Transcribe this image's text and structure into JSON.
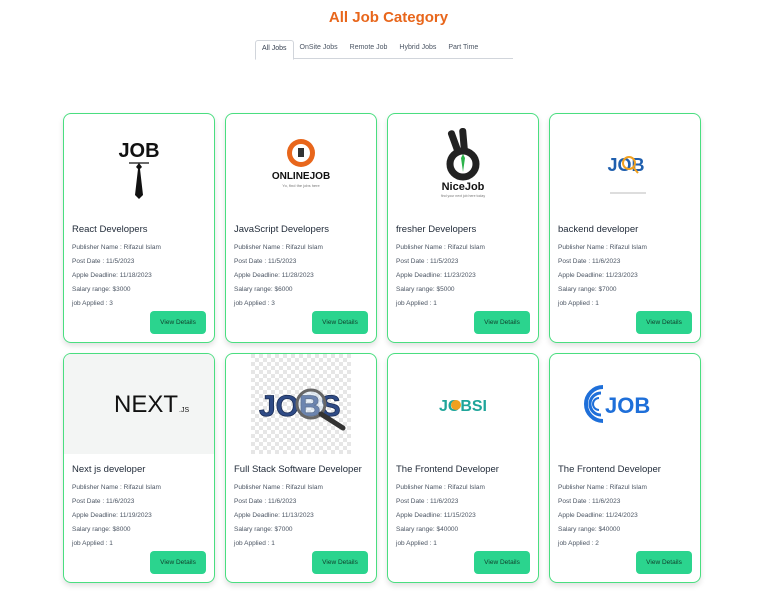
{
  "page": {
    "title": "All Job Category"
  },
  "tabs": [
    "All Jobs",
    "OnSite Jobs",
    "Remote Job",
    "Hybrid Jobs",
    "Part Time"
  ],
  "labels": {
    "publisher": "Publisher Name : ",
    "post_date": "Post Date : ",
    "deadline": "Apple Deadline: ",
    "salary": "Salary range: ",
    "applied": "job Applied : ",
    "button": "View Details"
  },
  "logo_text": {
    "job": "JOB",
    "onlinejob": "ONLINEJOB",
    "onlinejob_tag": "Yo, find the jobs here",
    "nicejob": "NiceJob",
    "nicejob_tag": "find your next job here today",
    "searchjob": "JOB",
    "nextjs": "NEXT",
    "nextjs_suffix": ".JS",
    "jobs": "JOBS",
    "jobsi": "JOBSI",
    "job_blue": "JOB"
  },
  "jobs": [
    {
      "title": "React Developers",
      "publisher": "Rifazul Islam",
      "post_date": "11/5/2023",
      "deadline": "11/18/2023",
      "salary": "$3000",
      "applied": "3"
    },
    {
      "title": "JavaScript Developers",
      "publisher": "Rifazul Islam",
      "post_date": "11/5/2023",
      "deadline": "11/28/2023",
      "salary": "$6000",
      "applied": "3"
    },
    {
      "title": "fresher Developers",
      "publisher": "Rifazul Islam",
      "post_date": "11/5/2023",
      "deadline": "11/23/2023",
      "salary": "$5000",
      "applied": "1"
    },
    {
      "title": "backend developer",
      "publisher": "Rifazul Islam",
      "post_date": "11/6/2023",
      "deadline": "11/23/2023",
      "salary": "$7000",
      "applied": "1"
    },
    {
      "title": "Next js developer",
      "publisher": "Rifazul Islam",
      "post_date": "11/6/2023",
      "deadline": "11/19/2023",
      "salary": "$8000",
      "applied": "1"
    },
    {
      "title": "Full Stack Software Developer",
      "publisher": "Rifazul Islam",
      "post_date": "11/6/2023",
      "deadline": "11/13/2023",
      "salary": "$7000",
      "applied": "1"
    },
    {
      "title": "The Frontend Developer",
      "publisher": "Rifazul Islam",
      "post_date": "11/6/2023",
      "deadline": "11/15/2023",
      "salary": "$40000",
      "applied": "1"
    },
    {
      "title": "The Frontend Developer",
      "publisher": "Rifazul Islam",
      "post_date": "11/6/2023",
      "deadline": "11/24/2023",
      "salary": "$40000",
      "applied": "2"
    }
  ],
  "colors": {
    "accent": "#e8661b",
    "button": "#2bd48e",
    "card_border": "#4ade80"
  }
}
